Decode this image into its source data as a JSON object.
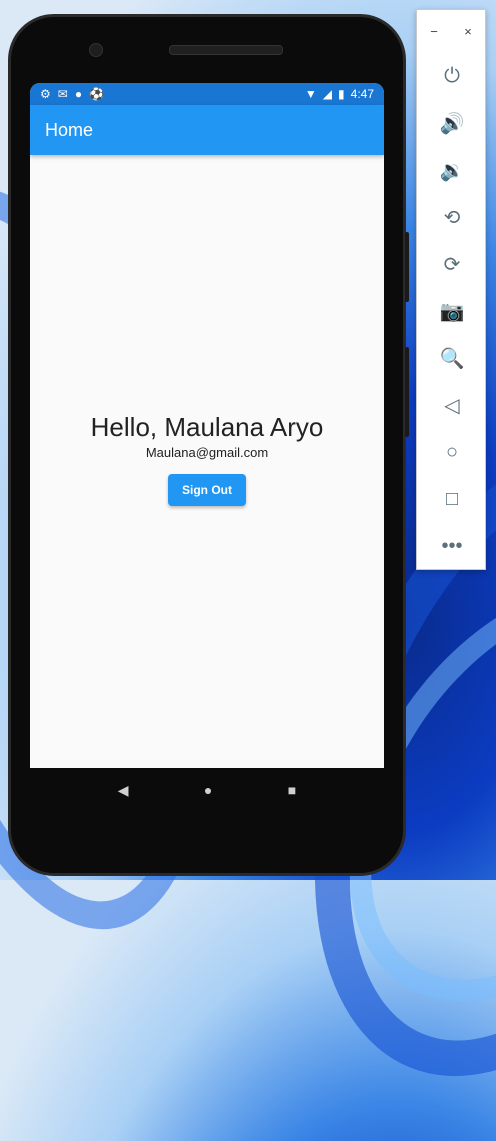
{
  "status_bar": {
    "time": "4:47",
    "left_icons": [
      "gear-icon",
      "gmail-icon",
      "circle-icon",
      "soccer-ball-icon"
    ],
    "right_icons": [
      "wifi-icon",
      "signal-icon",
      "battery-icon"
    ]
  },
  "app_bar": {
    "title": "Home"
  },
  "main": {
    "greeting": "Hello, Maulana Aryo",
    "email": "Maulana@gmail.com",
    "sign_out_label": "Sign Out"
  },
  "android_nav": {
    "back": "◀",
    "home": "●",
    "recents": "■"
  },
  "emulator_panel": {
    "minimize": "−",
    "close": "×",
    "tools": [
      {
        "name": "power-icon",
        "glyph": "⏻"
      },
      {
        "name": "volume-up-icon",
        "glyph": "🔊"
      },
      {
        "name": "volume-down-icon",
        "glyph": "🔉"
      },
      {
        "name": "rotate-left-icon",
        "glyph": "⟲"
      },
      {
        "name": "rotate-right-icon",
        "glyph": "⟳"
      },
      {
        "name": "camera-icon",
        "glyph": "📷"
      },
      {
        "name": "zoom-icon",
        "glyph": "🔍"
      },
      {
        "name": "back-icon",
        "glyph": "◁"
      },
      {
        "name": "home-icon",
        "glyph": "○"
      },
      {
        "name": "overview-icon",
        "glyph": "□"
      },
      {
        "name": "more-icon",
        "glyph": "•••"
      }
    ]
  },
  "colors": {
    "status_bar": "#1976d2",
    "app_bar": "#2196f3",
    "button": "#2196f3"
  }
}
